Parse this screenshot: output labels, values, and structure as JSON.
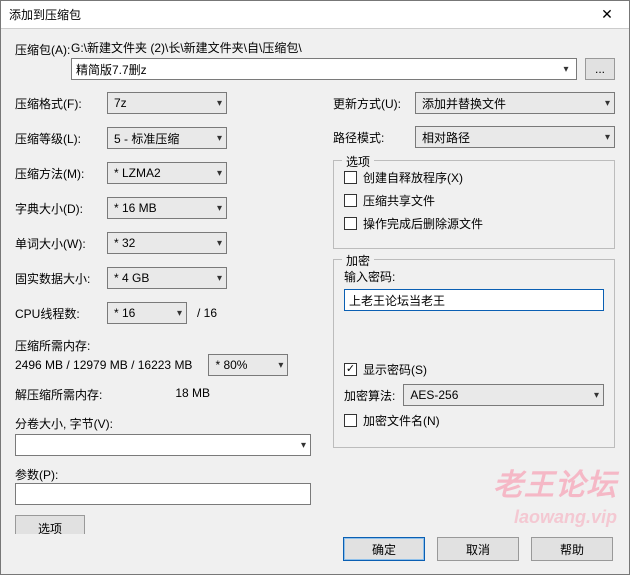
{
  "title": "添加到压缩包",
  "archive": {
    "label": "压缩包(A):",
    "path_display": "G:\\新建文件夹 (2)\\长\\新建文件夹\\自\\压缩包\\",
    "filename": "精简版7.7删z",
    "browse": "..."
  },
  "left": {
    "format": {
      "label": "压缩格式(F):",
      "value": "7z"
    },
    "level": {
      "label": "压缩等级(L):",
      "value": "5 - 标准压缩"
    },
    "method": {
      "label": "压缩方法(M):",
      "value": "* LZMA2"
    },
    "dict": {
      "label": "字典大小(D):",
      "value": "* 16 MB"
    },
    "word": {
      "label": "单词大小(W):",
      "value": "* 32"
    },
    "solid": {
      "label": "固实数据大小:",
      "value": "* 4 GB"
    },
    "cpu": {
      "label": "CPU线程数:",
      "value": "* 16",
      "suffix": "/ 16"
    },
    "mem_comp_label": "压缩所需内存:",
    "mem_comp_value": "2496 MB / 12979 MB / 16223 MB",
    "mem_comp_pct": "* 80%",
    "mem_decomp_label": "解压缩所需内存:",
    "mem_decomp_value": "18 MB",
    "volumes": {
      "label": "分卷大小, 字节(V):",
      "value": ""
    },
    "params": {
      "label": "参数(P):",
      "value": ""
    },
    "options_btn": "选项"
  },
  "right": {
    "update": {
      "label": "更新方式(U):",
      "value": "添加并替换文件"
    },
    "path": {
      "label": "路径模式:",
      "value": "相对路径"
    },
    "opts": {
      "title": "选项",
      "sfx": {
        "label": "创建自释放程序(X)",
        "checked": false
      },
      "share": {
        "label": "压缩共享文件",
        "checked": false
      },
      "del": {
        "label": "操作完成后删除源文件",
        "checked": false
      }
    },
    "enc": {
      "title": "加密",
      "pwd_label": "输入密码:",
      "pwd_value": "上老王论坛当老王",
      "show": {
        "label": "显示密码(S)",
        "checked": true
      },
      "algo": {
        "label": "加密算法:",
        "value": "AES-256"
      },
      "encnames": {
        "label": "加密文件名(N)",
        "checked": false
      }
    }
  },
  "buttons": {
    "ok": "确定",
    "cancel": "取消",
    "help": "帮助"
  },
  "watermark": {
    "main": "老王论坛",
    "sub": "laowang.vip"
  }
}
